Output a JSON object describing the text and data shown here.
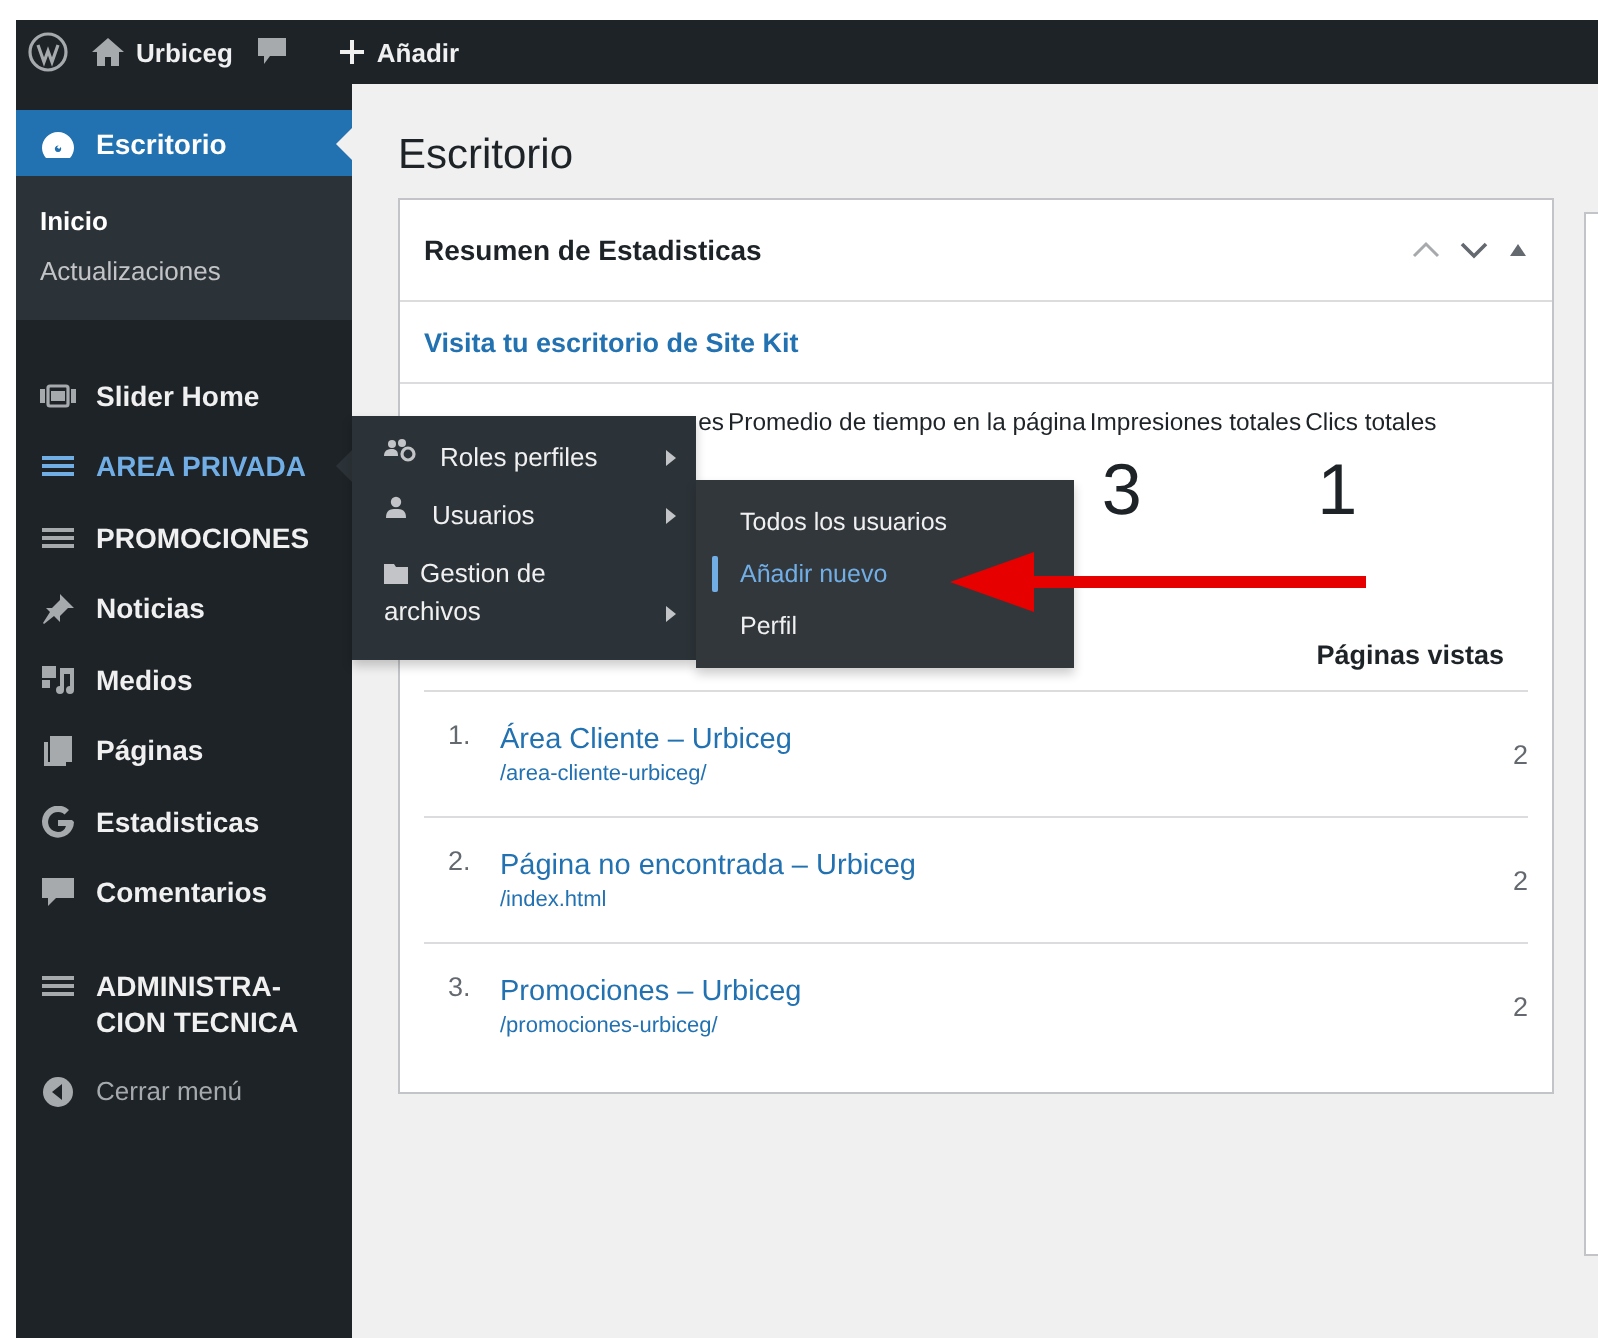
{
  "admin_bar": {
    "site_name": "Urbiceg",
    "new_label": "Añadir"
  },
  "sidebar": {
    "items": [
      {
        "kind": "item",
        "label": "Escritorio",
        "selected": true,
        "open": false,
        "children": [
          {
            "label": "Inicio",
            "selected": true
          },
          {
            "label": "Actualizaciones",
            "selected": false
          }
        ]
      },
      {
        "kind": "item",
        "label": "Slider Home",
        "selected": false,
        "open": false
      },
      {
        "kind": "item",
        "label": "AREA PRIVADA",
        "selected": false,
        "open": true
      },
      {
        "kind": "item",
        "label": "PROMOCIONES",
        "selected": false,
        "open": false
      },
      {
        "kind": "item",
        "label": "Noticias",
        "selected": false,
        "open": false
      },
      {
        "kind": "item",
        "label": "Medios",
        "selected": false,
        "open": false
      },
      {
        "kind": "item",
        "label": "Páginas",
        "selected": false,
        "open": false
      },
      {
        "kind": "item",
        "label": "Estadisticas",
        "selected": false,
        "open": false
      },
      {
        "kind": "item",
        "label": "Comentarios",
        "selected": false,
        "open": false
      },
      {
        "kind": "item",
        "label": "ADMINISTRA-CION TECNICA",
        "selected": false,
        "open": false
      },
      {
        "kind": "collapse",
        "label": "Cerrar menú",
        "selected": false,
        "open": false
      }
    ]
  },
  "flyout": {
    "items": [
      {
        "label": "Roles perfiles",
        "has_submenu": true
      },
      {
        "label": "Usuarios",
        "has_submenu": true
      },
      {
        "label": "Gestion de archivos",
        "has_submenu": true
      }
    ]
  },
  "submenu": {
    "items": [
      {
        "label": "Todos los usuarios",
        "selected": false
      },
      {
        "label": "Añadir nuevo",
        "selected": true
      },
      {
        "label": "Perfil",
        "selected": false
      }
    ]
  },
  "page_title": "Escritorio",
  "widget": {
    "title": "Resumen de Estadisticas",
    "link": "Visita tu escritorio de Site Kit",
    "stats": [
      {
        "label": "es"
      },
      {
        "label": "Promedio de tiempo en la página"
      },
      {
        "label": "Impresiones totales",
        "value": "3"
      },
      {
        "label": "Clics totales",
        "value": "1"
      }
    ],
    "views_header": "Páginas vistas",
    "rows": [
      {
        "rank": "1.",
        "title": "Área Cliente – Urbiceg",
        "path": "/area-cliente-urbiceg/",
        "views": "2"
      },
      {
        "rank": "2.",
        "title": "Página no encontrada – Urbiceg",
        "path": "/index.html",
        "views": "2"
      },
      {
        "rank": "3.",
        "title": "Promociones – Urbiceg",
        "path": "/promociones-urbiceg/",
        "views": "2"
      }
    ]
  }
}
